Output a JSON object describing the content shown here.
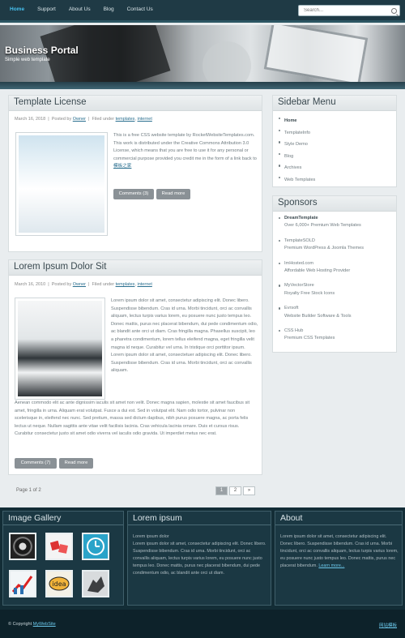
{
  "nav": {
    "items": [
      "Home",
      "Support",
      "About Us",
      "Blog",
      "Contact Us"
    ]
  },
  "search": {
    "placeholder": "Search..."
  },
  "header": {
    "brand": "Business Portal",
    "tagline": "Simple web template"
  },
  "posts": [
    {
      "title": "Template License",
      "date": "March 16, 2018",
      "posted_by_label": "Posted by",
      "author": "Owner",
      "filed_label": "Filed under",
      "tag1": "templates",
      "tag2": "internet",
      "body": "This is a free CSS website template by RocketWebsiteTemplates.com. This work is distributed under the Creative Commons Attribution 3.0 License, which means that you are free to use it for any personal or commercial purpose provided you credit me in the form of a link back to",
      "link": "模板之家",
      "comments_btn": "Comments (3)",
      "readmore_btn": "Read more"
    },
    {
      "title": "Lorem Ipsum Dolor Sit",
      "date": "March 16, 2010",
      "posted_by_label": "Posted by",
      "author": "Owner",
      "filed_label": "Filed under",
      "tag1": "templates",
      "tag2": "internet",
      "body": "Lorem ipsum dolor sit amet, consectetur adipiscing elit. Donec libero. Suspendisse bibendum. Cras id urna. Morbi tincidunt, orci ac convallis aliquam, lectus turpis varius lorem, eu posuere nunc justo tempus leo. Donec mattis, purus nec placerat bibendum, dui pede condimentum odio, ac blandit ante orci ut diam. Cras fringilla magna. Phasellus suscipit, leo a pharetra condimentum, lorem tellus eleifend magna, eget fringilla velit magna id neque. Curabitur vel urna. In tristique orci porttitor ipsum. Lorem ipsum dolor sit amet, consectetuer adipiscing elit. Donec libero. Suspendisse bibendum. Cras id urna. Morbi tincidunt, orci ac convallis aliquam.",
      "body2": "Aenean commodo elit ac ante dignissim iaculis sit amet non velit. Donec magna sapien, molestie sit amet faucibus sit amet, fringilla in urna. Aliquam erat volutpat. Fusce a dui est. Sed in volutpat elit. Nam odio tortor, pulvinar non scelerisque in, eleifend nec nunc. Sed pretium, massa sed dictum dapibus, nibh purus posuere magna, ac porta felis lectus ut neque. Nullam sagittis ante vitae velit facilisis lacinia. Cras vehicula lacinia ornare. Duis et cursus risus. Curabitur consectetur justo sit amet odio viverra vel iaculis odio gravida. Ut imperdiet metus nec erat.",
      "comments_btn": "Comments (7)",
      "readmore_btn": "Read more"
    }
  ],
  "pager": {
    "label": "Page 1 of 2",
    "pages": [
      "1",
      "2",
      "»"
    ]
  },
  "sidebar": {
    "title": "Sidebar Menu",
    "items": [
      "Home",
      "TemplateInfo",
      "Style Demo",
      "Blog",
      "Archives",
      "Web Templates"
    ]
  },
  "sponsors": {
    "title": "Sponsors",
    "items": [
      {
        "name": "DreamTemplate",
        "desc": "Over 6,000+ Premium Web Templates"
      },
      {
        "name": "TemplateSOLD",
        "desc": "Premium WordPress & Joomla Themes"
      },
      {
        "name": "ImHosted.com",
        "desc": "Affordable Web Hosting Provider"
      },
      {
        "name": "MyVectorStore",
        "desc": "Royalty Free Stock Icons"
      },
      {
        "name": "Evrsoft",
        "desc": "Website Builder Software & Tools"
      },
      {
        "name": "CSS Hub",
        "desc": "Premium CSS Templates"
      }
    ]
  },
  "footer": {
    "gallery_title": "Image Gallery",
    "gallery_icons": [
      "camera-lens-icon",
      "dice-icon",
      "clock-icon",
      "growth-chart-icon",
      "idea-bulb-icon",
      "hand-icon"
    ],
    "lorem_title": "Lorem ipsum",
    "lorem_head": "Lorem ipsum dolor",
    "lorem_text": "Lorem ipsum dolor sit amet, consectetur adipiscing elit. Donec libero. Suspendisse bibendum. Cras id urna. Morbi tincidunt, orci ac convallis aliquam, lectus turpis varius lorem, eu posuere nunc justo tempus leo. Donec mattis, purus nec placerat bibendum, dui pede condimentum odio, ac blandit ante orci ut diam.",
    "about_title": "About",
    "about_text": "Lorem ipsum dolor sit amet, consectetur adipiscing elit. Donec libero. Suspendisse bibendum. Cras id urna. Morbi tincidunt, orci ac convallis aliquam, lectus turpis varius lorem, eu posuere nunc justo tempus leo. Donec mattis, purus nec placerat bibendum.",
    "about_link": "Learn more...",
    "copyright": "© Copyright",
    "copyright_link": "MyWebSite",
    "right_link": "网站模板"
  },
  "colors": {
    "accent": "#47c2f0",
    "nav_bg": "#1f3a45",
    "footer_bg": "#132d36"
  }
}
